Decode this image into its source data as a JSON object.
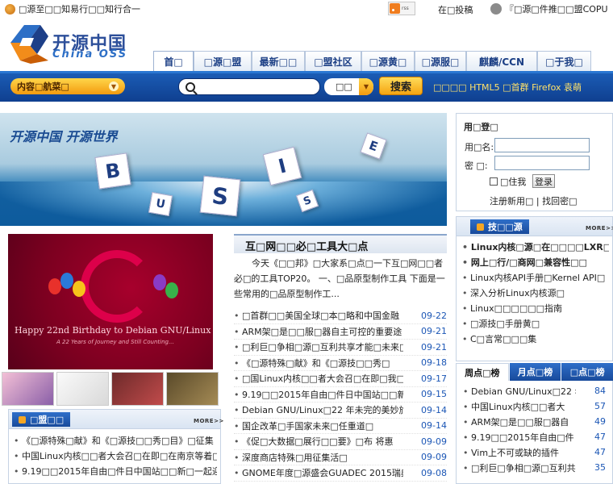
{
  "top": {
    "home_link": "□源至□□知易行□□知行合一",
    "rss_label": "rss",
    "submit_link": "在□投稿",
    "promo_link": "『□源□件推□□盟COPU"
  },
  "logo": {
    "cn": "开源中国",
    "en": "China OSS"
  },
  "nav": {
    "tabs": [
      {
        "label": "首□"
      },
      {
        "label": "□源□盟"
      },
      {
        "label": "最新□□"
      },
      {
        "label": "□盟社区"
      },
      {
        "label": "□源黄□"
      },
      {
        "label": "□源服□"
      },
      {
        "label": "麒麟/CCN"
      },
      {
        "label": "□于我□"
      }
    ]
  },
  "search": {
    "category_label": "内容□航菜□",
    "placeholder": "",
    "type_label": "□□",
    "button_label": "搜索",
    "hotwords": "□□□□ HTML5 □首群 Firefox 袁萌"
  },
  "banner": {
    "slogan": "开源中国  开源世界",
    "cube_letters": [
      "B",
      "U",
      "S",
      "I",
      "E",
      "S"
    ]
  },
  "login": {
    "title": "用□登□",
    "username_label": "用□名:",
    "password_label": "密  □:",
    "remember_label": "□住我",
    "login_button": "登录",
    "register_link": "注册新用□",
    "forgot_link": "找回密□"
  },
  "poster": {
    "caption": "Happy 22nd Birthday to Debian GNU/Linux",
    "subcaption": "A 22 Years of Journey and Still Counting..."
  },
  "headline": {
    "title": "互□网□□必□工具大□点",
    "desc": "今天《□□邦》□大家系□点□一下互□网□□者必□的工具TOP20。    一、□品原型制作工具    下面是一些常用的□品原型制作工..."
  },
  "news": [
    {
      "title": "□首群□□美国全球□本□略和中国金融",
      "date": "09-22"
    },
    {
      "title": "ARM架□是□□服□器自主可控的重要途",
      "date": "09-21"
    },
    {
      "title": "□利巨□争相□源□互利共享才能□未来□",
      "date": "09-21"
    },
    {
      "title": "《□源特殊□献》和《□源技□□秀□",
      "date": "09-18"
    },
    {
      "title": "□国Linux内核□□者大会召□在即□我□",
      "date": "09-17"
    },
    {
      "title": "9.19□□2015年自由□件日中国站□□新",
      "date": "09-15"
    },
    {
      "title": "Debian GNU/Linux□22 年未完的美妙旅程",
      "date": "09-14"
    },
    {
      "title": "国企改革□手国家未来□任重道□",
      "date": "09-14"
    },
    {
      "title": "《促□大数据□展行□□要》□布 将惠",
      "date": "09-09"
    },
    {
      "title": "深度商店特殊□用征集活□",
      "date": "09-09"
    },
    {
      "title": "GNOME年度□源盛会GUADEC 2015瑞典全",
      "date": "09-08"
    }
  ],
  "tech": {
    "title": "技□□源",
    "more": "MORE>>",
    "items": [
      {
        "label": "Linux内核□源□在□□□□LXR□",
        "bold": true
      },
      {
        "label": "网上□行/□商网□兼容性□□",
        "bold": true
      },
      {
        "label": "Linux内核API手册□Kernel API□",
        "bold": false
      },
      {
        "label": "深入分析Linux内核源□",
        "bold": false
      },
      {
        "label": "Linux□□□□□□指南",
        "bold": false
      },
      {
        "label": "□源技□手册黄□",
        "bold": false
      },
      {
        "label": "C□言常□□□集",
        "bold": false
      }
    ]
  },
  "rank": {
    "tabs": [
      {
        "label": "周点□榜"
      },
      {
        "label": "月点□榜"
      },
      {
        "label": "□点□榜"
      }
    ],
    "rows": [
      {
        "title": "Debian GNU/Linux□22 年",
        "count": "84"
      },
      {
        "title": "中国Linux内核□□者大",
        "count": "57"
      },
      {
        "title": "ARM架□是□□服□器自",
        "count": "49"
      },
      {
        "title": "9.19□□2015年自由□件",
        "count": "47"
      },
      {
        "title": "Vim上不可或缺的插件",
        "count": "47"
      },
      {
        "title": "□利巨□争相□源□互利共",
        "count": "35"
      }
    ]
  },
  "league": {
    "title": "□盟□□",
    "more": "MORE>>",
    "items": [
      {
        "label": "《□源特殊□献》和《□源技□□秀□目》□征集"
      },
      {
        "label": "中国Linux内核□□者大会召□在即□在南京等着□"
      },
      {
        "label": "9.19□□2015年自由□件日中国站□□新□一起迎"
      }
    ]
  },
  "colors": {
    "brand_blue": "#1b5cb5",
    "accent_orange": "#f5a411",
    "link_blue": "#1b56b5"
  }
}
